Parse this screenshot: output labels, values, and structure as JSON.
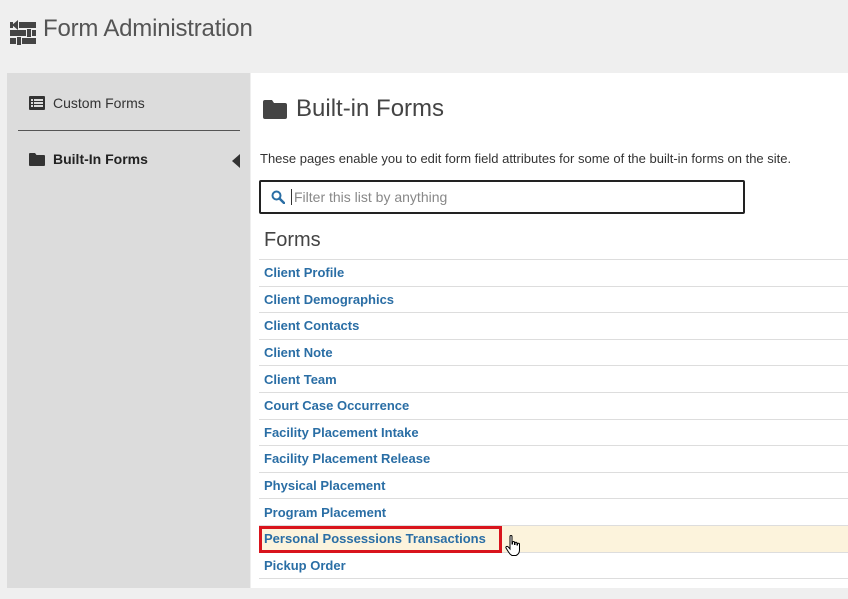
{
  "header": {
    "title": "Form Administration",
    "icon": "settings-sliders-icon"
  },
  "sidebar": {
    "items": [
      {
        "label": "Custom Forms",
        "icon": "list-icon",
        "active": false
      },
      {
        "label": "Built-In Forms",
        "icon": "folder-icon",
        "active": true
      }
    ]
  },
  "main": {
    "title": "Built-in Forms",
    "title_icon": "folder-icon",
    "description": "These pages enable you to edit form field attributes for some of the built-in forms on the site.",
    "search": {
      "placeholder": "Filter this list by anything",
      "value": "",
      "icon": "search-icon"
    },
    "forms_heading": "Forms",
    "forms": [
      {
        "label": "Client Profile"
      },
      {
        "label": "Client Demographics"
      },
      {
        "label": "Client Contacts"
      },
      {
        "label": "Client Note"
      },
      {
        "label": "Client Team"
      },
      {
        "label": "Court Case Occurrence"
      },
      {
        "label": "Facility Placement Intake"
      },
      {
        "label": "Facility Placement Release"
      },
      {
        "label": "Physical Placement"
      },
      {
        "label": "Program Placement"
      },
      {
        "label": "Personal Possessions Transactions",
        "hovered": true,
        "highlighted": true
      },
      {
        "label": "Pickup Order"
      }
    ]
  },
  "colors": {
    "link": "#2a6ea5",
    "highlight_border": "#d9141c",
    "hover_row": "#fcf3dc",
    "sidebar_bg": "#dcdcdc",
    "page_bg": "#efefef"
  }
}
